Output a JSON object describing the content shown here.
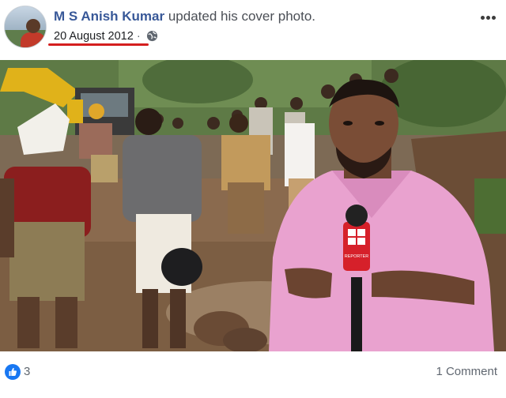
{
  "post": {
    "author_name": "M S Anish Kumar",
    "action_text": "updated his cover photo.",
    "date": "20 August 2012",
    "separator": "·",
    "privacy_icon": "globe-icon",
    "menu_icon": "more-options-icon",
    "photo": {
      "mic_logo_text": "REPORTER"
    }
  },
  "reactions": {
    "like_icon": "like-icon",
    "like_count": "3",
    "comment_count_text": "1 Comment"
  },
  "colors": {
    "author_link": "#385898",
    "like_blue": "#1877f2",
    "underline_red": "#d41f1f",
    "mic_red": "#d6202a"
  }
}
